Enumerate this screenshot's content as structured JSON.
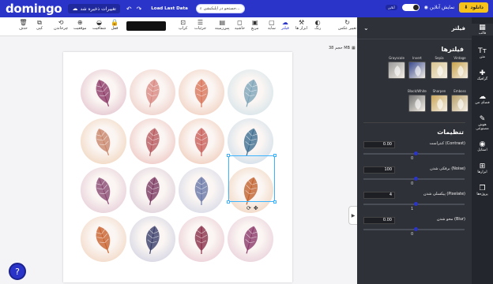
{
  "app": {
    "logo": "domingo",
    "save_status": "تغییرات ذخیره شد",
    "load_last": "Load Last Data",
    "search_placeholder": "جستجو در اپلیکیشن...",
    "toggle_label": "آنلاین",
    "preview_label": "نمایش آنلاین",
    "download_label": "دانلود"
  },
  "toolbar": {
    "tools": [
      {
        "label": "تغییر عکس",
        "icon": "↻",
        "active": false
      },
      {
        "label": "رنگ",
        "icon": "◐",
        "active": false
      },
      {
        "label": "ابزار ها",
        "icon": "⚒",
        "active": false
      },
      {
        "label": "فیلتر",
        "icon": "☁",
        "active": true
      },
      {
        "label": "سایه",
        "icon": "▢",
        "active": false
      },
      {
        "label": "مربع",
        "icon": "▣",
        "active": false
      },
      {
        "label": "حاشیه",
        "icon": "◻",
        "active": false
      },
      {
        "label": "پس‌زمینه",
        "icon": "▤",
        "active": false
      },
      {
        "label": "جزئیات",
        "icon": "☰",
        "active": false
      },
      {
        "label": "کراپ",
        "icon": "⊡",
        "active": false
      },
      {
        "label": "قفل",
        "icon": "🔒",
        "active": false
      },
      {
        "label": "شفافیت",
        "icon": "◒",
        "active": false
      },
      {
        "label": "موقعیت",
        "icon": "⊕",
        "active": false
      },
      {
        "label": "چرخاندن",
        "icon": "⟲",
        "active": false
      },
      {
        "label": "کپی",
        "icon": "⧉",
        "active": false
      },
      {
        "label": "حذف",
        "icon": "🗑",
        "active": false
      }
    ]
  },
  "canvas": {
    "size_label": "حجم 38 MB"
  },
  "panel": {
    "title": "فیلتر",
    "filters_title": "فیلترها",
    "filters": [
      {
        "name": "Vintage",
        "color": "#c9a24a"
      },
      {
        "name": "Sepia",
        "color": "#d9c48f"
      },
      {
        "name": "Invert",
        "color": "#3a4a8f"
      },
      {
        "name": "Grayscale",
        "color": "#9a9a9a"
      },
      {
        "name": "Emboss",
        "color": "#b8a06a"
      },
      {
        "name": "Sharpen",
        "color": "#caa65a"
      },
      {
        "name": "Black/White",
        "color": "#777777"
      }
    ],
    "settings_title": "تنظیمات",
    "adjustments": [
      {
        "label": "کنتراست (Contrast)",
        "value": "0.00",
        "scale": "0"
      },
      {
        "label": "برفکی شدن (Noise)",
        "value": "100",
        "scale": "0"
      },
      {
        "label": "پیکسلی شدن (Pixelate)",
        "value": "4",
        "scale": "1"
      },
      {
        "label": "محو شدن (Blur)",
        "value": "0.00",
        "scale": "0"
      }
    ]
  },
  "sidebar": {
    "items": [
      {
        "label": "قالب",
        "icon": "▦"
      },
      {
        "label": "متن",
        "icon": "Tт"
      },
      {
        "label": "گرافیک",
        "icon": "✚"
      },
      {
        "label": "فضای من",
        "icon": "☁"
      },
      {
        "label": "هوش مصنوعی",
        "icon": "✎"
      },
      {
        "label": "استایل",
        "icon": "◉"
      },
      {
        "label": "ابزارها",
        "icon": "⊞"
      },
      {
        "label": "پروژه‌ها",
        "icon": "❐"
      }
    ]
  },
  "help_label": "?",
  "leaves": [
    {
      "bg": "#e6c9d3",
      "leaf": "#8c3a66"
    },
    {
      "bg": "#f0d2cc",
      "leaf": "#d98a82"
    },
    {
      "bg": "#f2d3c4",
      "leaf": "#d9755a"
    },
    {
      "bg": "#d8e5ea",
      "leaf": "#7ea5b8"
    },
    {
      "bg": "#f2d8c2",
      "leaf": "#c9866a"
    },
    {
      "bg": "#efcbc7",
      "leaf": "#b85a5e"
    },
    {
      "bg": "#f1d0c0",
      "leaf": "#c9605a"
    },
    {
      "bg": "#d3e0ea",
      "leaf": "#3f6e90"
    },
    {
      "bg": "#e8d0da",
      "leaf": "#8a4a72"
    },
    {
      "bg": "#e0d2dc",
      "leaf": "#7a3860"
    },
    {
      "bg": "#d9dbe8",
      "leaf": "#6a78a8"
    },
    {
      "bg": "#f2d8c4",
      "leaf": "#c2622e"
    },
    {
      "bg": "#f3dac8",
      "leaf": "#c9622e"
    },
    {
      "bg": "#d6d6e4",
      "leaf": "#3a3f6a"
    },
    {
      "bg": "#ecd0d8",
      "leaf": "#8a2e48"
    },
    {
      "bg": "#ead2dc",
      "leaf": "#8c3a6a"
    }
  ]
}
